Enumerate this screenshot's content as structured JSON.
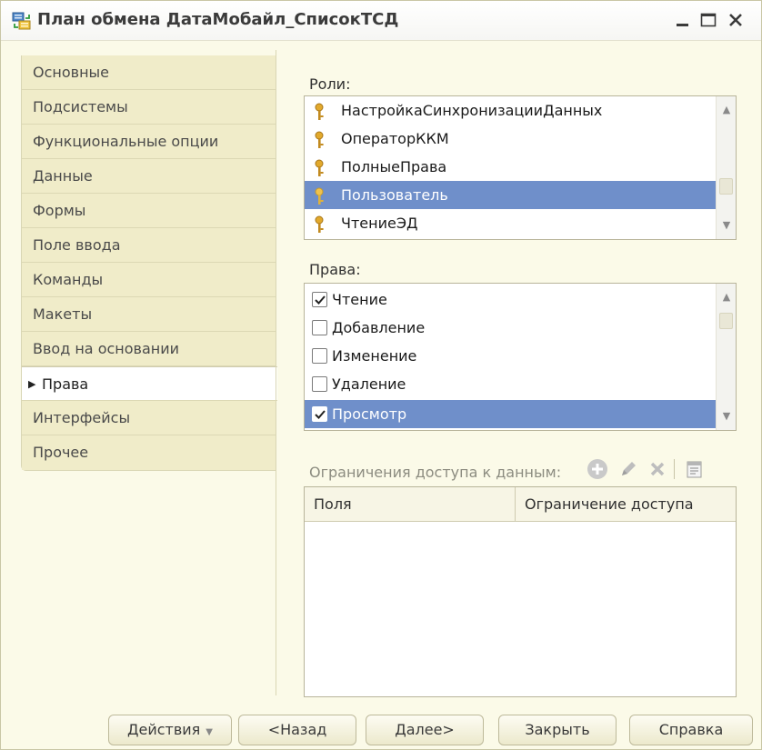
{
  "window": {
    "title": "План обмена ДатаМобайл_СписокТСД",
    "icon": "exchange-plan-icon",
    "controls": [
      "minimize-icon",
      "maximize-icon",
      "close-icon"
    ]
  },
  "tabs": [
    {
      "label": "Основные",
      "active": false
    },
    {
      "label": "Подсистемы",
      "active": false
    },
    {
      "label": "Функциональные опции",
      "active": false
    },
    {
      "label": "Данные",
      "active": false
    },
    {
      "label": "Формы",
      "active": false
    },
    {
      "label": "Поле ввода",
      "active": false
    },
    {
      "label": "Команды",
      "active": false
    },
    {
      "label": "Макеты",
      "active": false
    },
    {
      "label": "Ввод на основании",
      "active": false
    },
    {
      "label": "Права",
      "active": true
    },
    {
      "label": "Интерфейсы",
      "active": false
    },
    {
      "label": "Прочее",
      "active": false
    }
  ],
  "roles": {
    "label": "Роли:",
    "items": [
      {
        "name": "НастройкаСинхронизацииДанных",
        "selected": false
      },
      {
        "name": "ОператорККМ",
        "selected": false
      },
      {
        "name": "ПолныеПрава",
        "selected": false
      },
      {
        "name": "Пользователь",
        "selected": true
      },
      {
        "name": "ЧтениеЭД",
        "selected": false
      }
    ]
  },
  "rights": {
    "label": "Права:",
    "items": [
      {
        "name": "Чтение",
        "checked": true,
        "selected": false
      },
      {
        "name": "Добавление",
        "checked": false,
        "selected": false
      },
      {
        "name": "Изменение",
        "checked": false,
        "selected": false
      },
      {
        "name": "Удаление",
        "checked": false,
        "selected": false
      },
      {
        "name": "Просмотр",
        "checked": true,
        "selected": true
      }
    ]
  },
  "restrictions": {
    "label": "Ограничения доступа к данным:",
    "toolbar": [
      "add-icon",
      "edit-icon",
      "delete-icon",
      "template-icon"
    ],
    "columns": [
      "Поля",
      "Ограничение доступа"
    ],
    "rows": []
  },
  "buttons": {
    "actions": "Действия",
    "back": "<Назад",
    "next": "Далее>",
    "close": "Закрыть",
    "help": "Справка"
  },
  "colors": {
    "selection": "#6f8fca",
    "background": "#fbfae8",
    "tab": "#f0ecc9"
  }
}
